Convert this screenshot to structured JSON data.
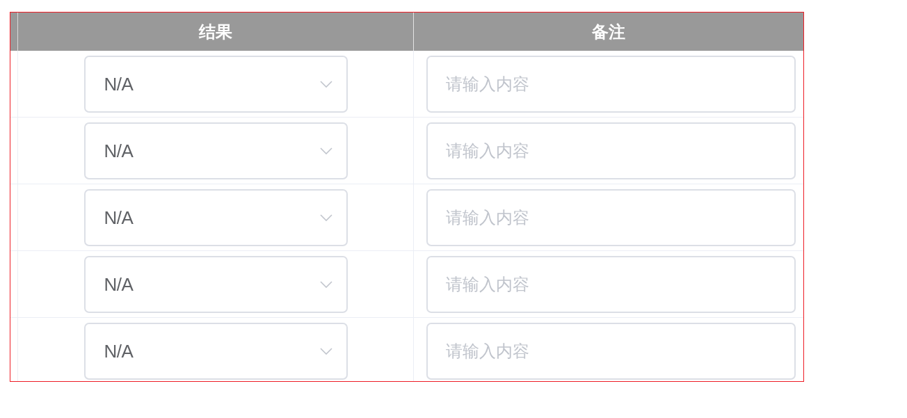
{
  "table": {
    "columns": [
      {
        "label": "结果"
      },
      {
        "label": "备注"
      }
    ],
    "rows": [
      {
        "result": {
          "value": "N/A"
        },
        "remark": {
          "placeholder": "请输入内容"
        }
      },
      {
        "result": {
          "value": "N/A"
        },
        "remark": {
          "placeholder": "请输入内容"
        }
      },
      {
        "result": {
          "value": "N/A"
        },
        "remark": {
          "placeholder": "请输入内容"
        }
      },
      {
        "result": {
          "value": "N/A"
        },
        "remark": {
          "placeholder": "请输入内容"
        }
      },
      {
        "result": {
          "value": "N/A"
        },
        "remark": {
          "placeholder": "请输入内容"
        }
      }
    ]
  }
}
